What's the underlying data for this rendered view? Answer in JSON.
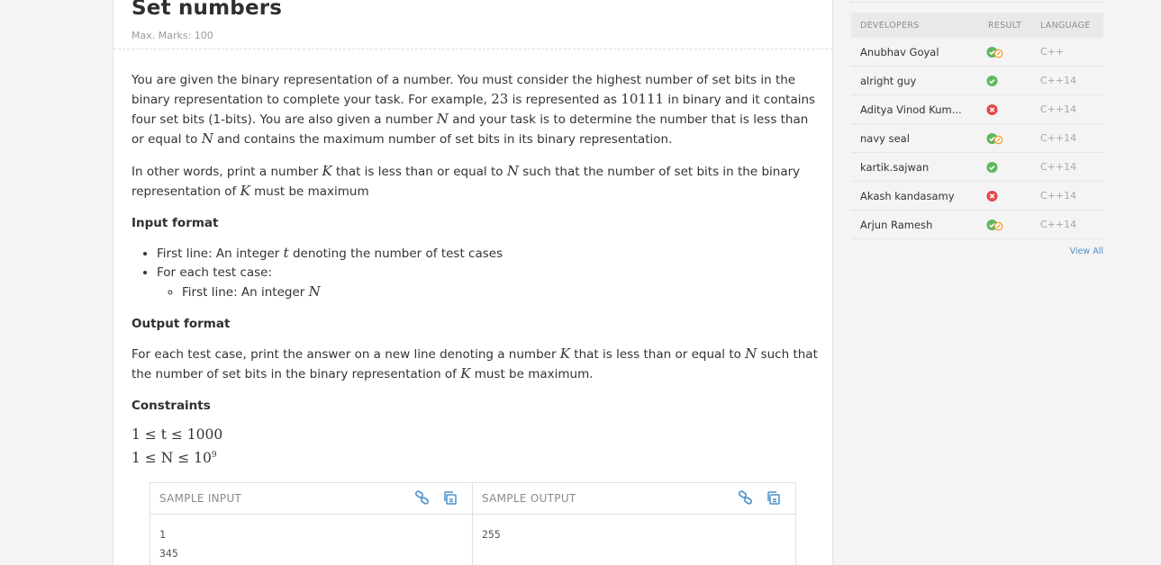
{
  "problem": {
    "title": "Set numbers",
    "max_marks": "Max. Marks: 100",
    "para1": {
      "t1": "You are given the binary representation of a number. You must consider the highest number of set bits in the binary representation to complete your task. For example, ",
      "n1": "23",
      "t2": " is represented as ",
      "n2": "10111",
      "t3": " in binary and it contains four set bits (1-bits). You are also given a number ",
      "v1": "N",
      "t4": " and your task is to determine the number that is less than or equal to ",
      "v2": "N",
      "t5": " and contains the maximum number of set bits in its binary representation."
    },
    "para2": {
      "t1": "In other words, print a number ",
      "v1": "K",
      "t2": " that is less than or equal to ",
      "v2": "N",
      "t3": " such that the number of set bits in the binary representation of ",
      "v3": "K",
      "t4": " must be maximum"
    },
    "input_heading": "Input format",
    "input_items": {
      "first_a": "First line: An integer ",
      "first_v": "t",
      "first_b": " denoting the number of test cases",
      "each": "For each test case:",
      "sub_a": "First line: An integer ",
      "sub_v": "N"
    },
    "output_heading": "Output format",
    "output_text": {
      "t1": "For each test case, print the answer on a new line denoting a number ",
      "v1": "K",
      "t2": " that is less than or equal to ",
      "v2": "N",
      "t3": " such that the number of set bits in the binary representation of ",
      "v3": "K",
      "t4": " must be maximum."
    },
    "constraints_heading": "Constraints",
    "constraint1": "1 ≤ t ≤ 1000",
    "constraint2_base": "1 ≤ N ≤ 10",
    "constraint2_exp": "9",
    "sample_input_label": "SAMPLE INPUT",
    "sample_output_label": "SAMPLE OUTPUT",
    "sample_input": "1\n345",
    "sample_output": "255"
  },
  "leaderboard": {
    "headers": {
      "developers": "DEVELOPERS",
      "result": "RESULT",
      "language": "LANGUAGE"
    },
    "rows": [
      {
        "name": "Anubhav Goyal",
        "result": "partial",
        "language": "C++"
      },
      {
        "name": "alright guy",
        "result": "accepted",
        "language": "C++14"
      },
      {
        "name": "Aditya Vinod Kum...",
        "result": "wrong",
        "language": "C++14"
      },
      {
        "name": "navy seal",
        "result": "partial",
        "language": "C++14"
      },
      {
        "name": "kartik.sajwan",
        "result": "accepted",
        "language": "C++14"
      },
      {
        "name": "Akash kandasamy",
        "result": "wrong",
        "language": "C++14"
      },
      {
        "name": "Arjun Ramesh",
        "result": "partial",
        "language": "C++14"
      }
    ],
    "view_all": "View All"
  },
  "colors": {
    "accepted": "#5cb85c",
    "wrong": "#e04a4a",
    "partial": "#f0a33a",
    "link": "#4a90c8"
  },
  "icons": {
    "copy_link": "link-icon",
    "copy": "copy-icon"
  }
}
